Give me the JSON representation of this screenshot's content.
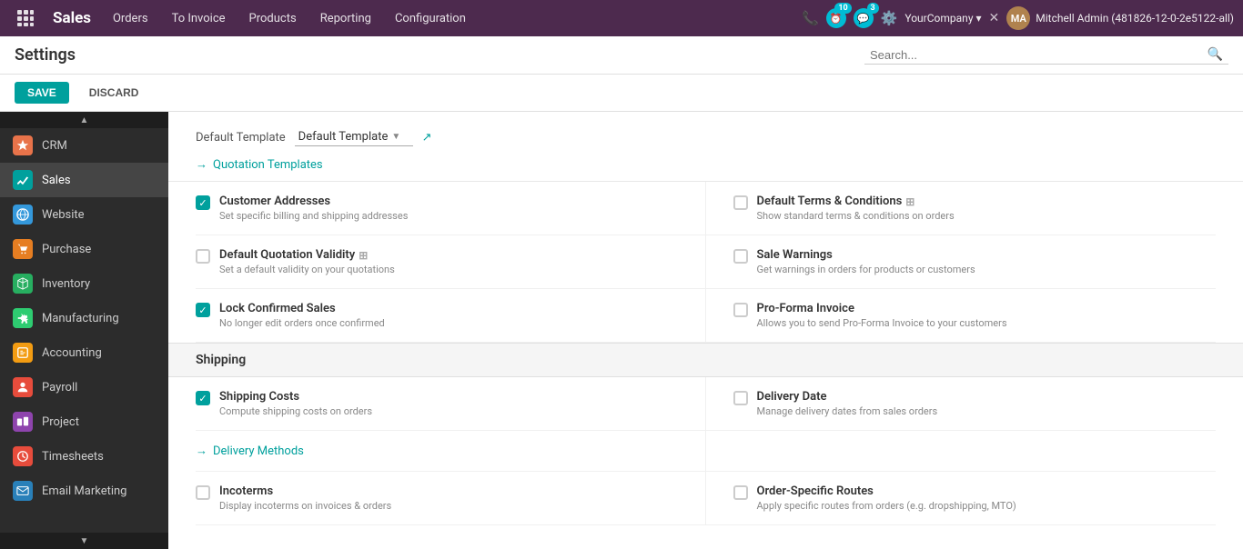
{
  "navbar": {
    "brand": "Sales",
    "menu_items": [
      "Orders",
      "To Invoice",
      "Products",
      "Reporting",
      "Configuration"
    ],
    "badge_count_activity": "10",
    "badge_count_messages": "3",
    "company": "YourCompany",
    "user": "Mitchell Admin (481826-12-0-2e5122-all)"
  },
  "header": {
    "title": "Settings",
    "search_placeholder": "Search..."
  },
  "actions": {
    "save_label": "SAVE",
    "discard_label": "DISCARD"
  },
  "sidebar": {
    "items": [
      {
        "id": "crm",
        "label": "CRM",
        "icon_class": "icon-crm",
        "icon_char": "📊"
      },
      {
        "id": "sales",
        "label": "Sales",
        "icon_class": "icon-sales",
        "icon_char": "📈",
        "active": true
      },
      {
        "id": "website",
        "label": "Website",
        "icon_class": "icon-website",
        "icon_char": "🌐"
      },
      {
        "id": "purchase",
        "label": "Purchase",
        "icon_class": "icon-purchase",
        "icon_char": "🛒"
      },
      {
        "id": "inventory",
        "label": "Inventory",
        "icon_class": "icon-inventory",
        "icon_char": "📦"
      },
      {
        "id": "manufacturing",
        "label": "Manufacturing",
        "icon_class": "icon-manufacturing",
        "icon_char": "🔧"
      },
      {
        "id": "accounting",
        "label": "Accounting",
        "icon_class": "icon-accounting",
        "icon_char": "💰"
      },
      {
        "id": "payroll",
        "label": "Payroll",
        "icon_class": "icon-payroll",
        "icon_char": "💵"
      },
      {
        "id": "project",
        "label": "Project",
        "icon_class": "icon-project",
        "icon_char": "📋"
      },
      {
        "id": "timesheets",
        "label": "Timesheets",
        "icon_class": "icon-timesheets",
        "icon_char": "⏱"
      },
      {
        "id": "email",
        "label": "Email Marketing",
        "icon_class": "icon-email",
        "icon_char": "📧"
      }
    ]
  },
  "settings": {
    "default_template": {
      "label": "Default Template",
      "value": "Default Template"
    },
    "quotation_templates_link": "Quotation Templates",
    "items": [
      {
        "id": "customer-addresses",
        "title": "Customer Addresses",
        "desc": "Set specific billing and shipping addresses",
        "checked": true,
        "has_icon": false
      },
      {
        "id": "default-terms",
        "title": "Default Terms & Conditions",
        "desc": "Show standard terms & conditions on orders",
        "checked": false,
        "has_icon": true
      },
      {
        "id": "quotation-validity",
        "title": "Default Quotation Validity",
        "desc": "Set a default validity on your quotations",
        "checked": false,
        "has_icon": true
      },
      {
        "id": "sale-warnings",
        "title": "Sale Warnings",
        "desc": "Get warnings in orders for products or customers",
        "checked": false,
        "has_icon": false
      },
      {
        "id": "lock-confirmed",
        "title": "Lock Confirmed Sales",
        "desc": "No longer edit orders once confirmed",
        "checked": true,
        "has_icon": false
      },
      {
        "id": "pro-forma",
        "title": "Pro-Forma Invoice",
        "desc": "Allows you to send Pro-Forma Invoice to your customers",
        "checked": false,
        "has_icon": false
      }
    ],
    "shipping_section": {
      "header": "Shipping",
      "items": [
        {
          "id": "shipping-costs",
          "title": "Shipping Costs",
          "desc": "Compute shipping costs on orders",
          "checked": true,
          "has_icon": false
        },
        {
          "id": "delivery-date",
          "title": "Delivery Date",
          "desc": "Manage delivery dates from sales orders",
          "checked": false,
          "has_icon": false
        },
        {
          "id": "delivery-methods-link",
          "is_link": true,
          "label": "Delivery Methods"
        },
        {
          "id": "incoterms",
          "title": "Incoterms",
          "desc": "Display incoterms on invoices & orders",
          "checked": false,
          "has_icon": false
        },
        {
          "id": "order-specific-routes",
          "title": "Order-Specific Routes",
          "desc": "Apply specific routes from orders (e.g. dropshipping, MTO)",
          "checked": false,
          "has_icon": false
        }
      ]
    }
  }
}
